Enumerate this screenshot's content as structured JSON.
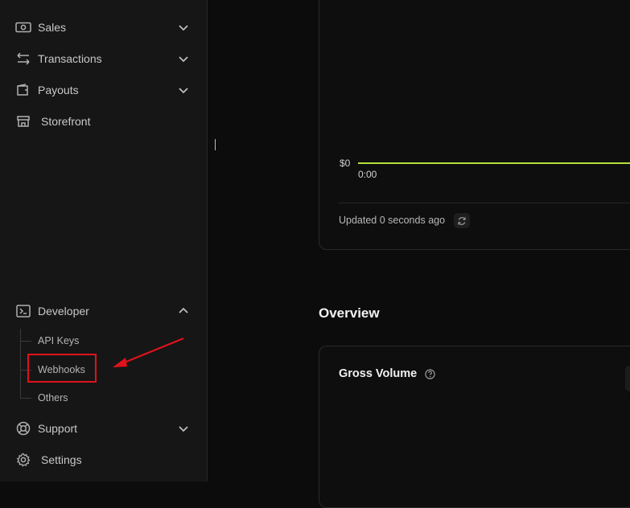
{
  "sidebar": {
    "items": [
      {
        "label": "Sales",
        "icon": "money-icon",
        "expandable": true
      },
      {
        "label": "Transactions",
        "icon": "transfer-arrows-icon",
        "expandable": true
      },
      {
        "label": "Payouts",
        "icon": "wallet-icon",
        "expandable": true
      },
      {
        "label": "Storefront",
        "icon": "store-icon",
        "expandable": false
      },
      {
        "label": "Developer",
        "icon": "terminal-icon",
        "expandable": true,
        "expanded": true
      },
      {
        "label": "Support",
        "icon": "lifebuoy-icon",
        "expandable": true
      },
      {
        "label": "Settings",
        "icon": "gear-icon",
        "expandable": false
      }
    ],
    "developer_subitems": [
      "API Keys",
      "Webhooks",
      "Others"
    ]
  },
  "chart": {
    "y_label": "$0",
    "x_label": "0:00",
    "updated_text": "Updated 0 seconds ago",
    "line_color": "#b5e03a"
  },
  "overview": {
    "title": "Overview",
    "gross_volume_title": "Gross Volume"
  },
  "annotation": {
    "color": "#e0121b"
  },
  "chart_data": {
    "type": "line",
    "x": [
      "0:00"
    ],
    "series": [
      {
        "values": [
          0
        ]
      }
    ],
    "ylim": [
      0,
      0
    ]
  }
}
